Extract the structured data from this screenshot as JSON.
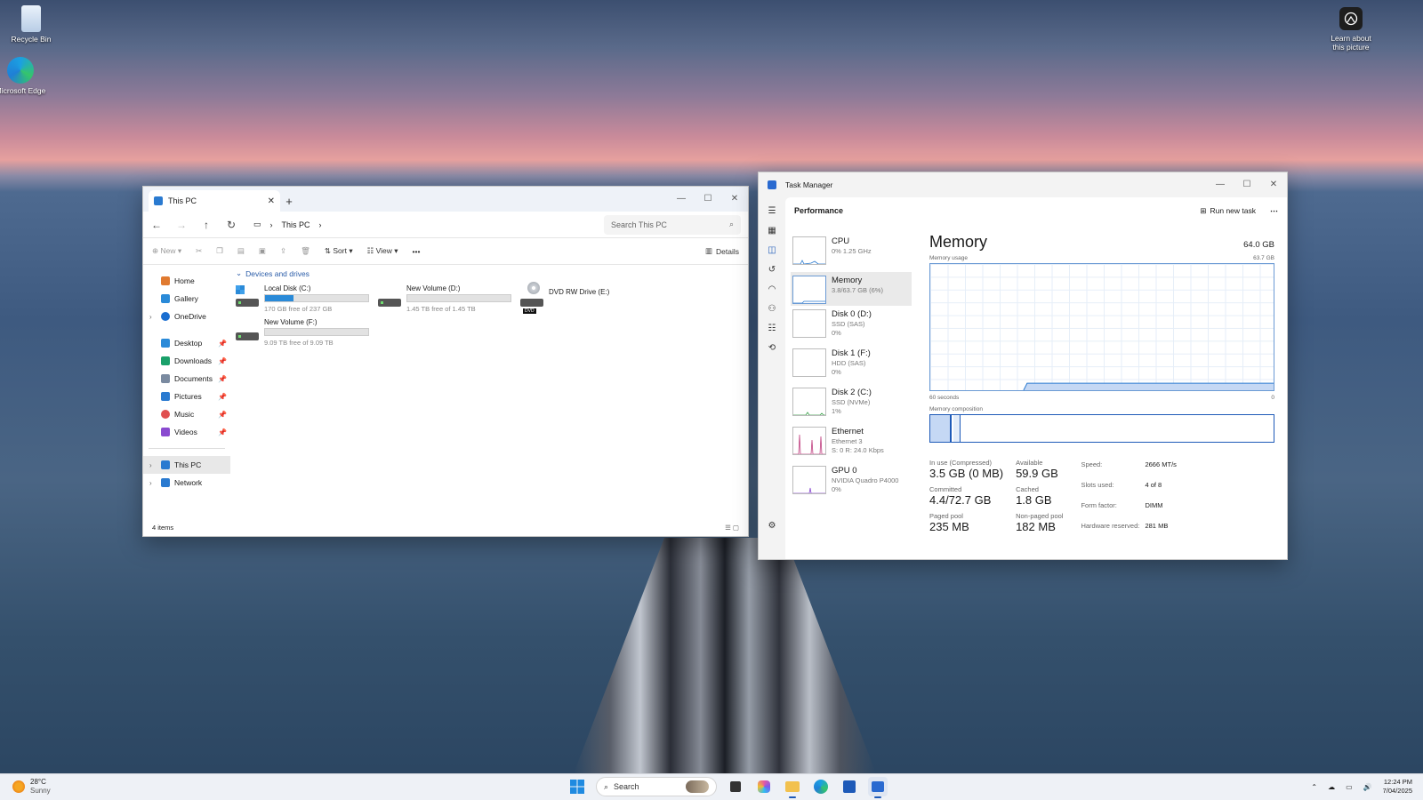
{
  "desktop": {
    "icons": [
      {
        "label": "Recycle Bin"
      },
      {
        "label": "Microsoft Edge"
      }
    ],
    "learn_label_line1": "Learn about",
    "learn_label_line2": "this picture"
  },
  "explorer": {
    "tab_title": "This PC",
    "address": "This PC",
    "search_placeholder": "Search This PC",
    "toolbar": {
      "new": "New",
      "sort": "Sort",
      "view": "View",
      "more": "•••",
      "details": "Details"
    },
    "sidebar": {
      "home": "Home",
      "gallery": "Gallery",
      "onedrive": "OneDrive",
      "desktop": "Desktop",
      "downloads": "Downloads",
      "documents": "Documents",
      "pictures": "Pictures",
      "music": "Music",
      "videos": "Videos",
      "this_pc": "This PC",
      "network": "Network"
    },
    "section_title": "Devices and drives",
    "drives": [
      {
        "name": "Local Disk (C:)",
        "free": "170 GB free of 237 GB",
        "used_fraction": 0.28
      },
      {
        "name": "New Volume (D:)",
        "free": "1.45 TB free of 1.45 TB",
        "used_fraction": 0.0
      },
      {
        "name": "DVD RW Drive (E:)",
        "badge": "DVD"
      },
      {
        "name": "New Volume (F:)",
        "free": "9.09 TB free of 9.09 TB",
        "used_fraction": 0.0
      }
    ],
    "status": "4 items"
  },
  "taskmgr": {
    "title": "Task Manager",
    "page": "Performance",
    "run_new_task": "Run new task",
    "resources": [
      {
        "name": "CPU",
        "sub1": "0% 1.25 GHz",
        "sub2": ""
      },
      {
        "name": "Memory",
        "sub1": "3.8/63.7 GB (6%)",
        "sub2": ""
      },
      {
        "name": "Disk 0 (D:)",
        "sub1": "SSD (SAS)",
        "sub2": "0%"
      },
      {
        "name": "Disk 1 (F:)",
        "sub1": "HDD (SAS)",
        "sub2": "0%"
      },
      {
        "name": "Disk 2 (C:)",
        "sub1": "SSD (NVMe)",
        "sub2": "1%"
      },
      {
        "name": "Ethernet",
        "sub1": "Ethernet 3",
        "sub2": "S: 0 R: 24.0 Kbps"
      },
      {
        "name": "GPU 0",
        "sub1": "NVIDIA Quadro P4000",
        "sub2": "0%"
      }
    ],
    "memory": {
      "title": "Memory",
      "total": "64.0 GB",
      "usage_label": "Memory usage",
      "usage_max": "63.7 GB",
      "axis_left": "60 seconds",
      "axis_right": "0",
      "composition_label": "Memory composition",
      "stats": {
        "in_use_label": "In use (Compressed)",
        "in_use": "3.5 GB (0 MB)",
        "available_label": "Available",
        "available": "59.9 GB",
        "committed_label": "Committed",
        "committed": "4.4/72.7 GB",
        "cached_label": "Cached",
        "cached": "1.8 GB",
        "paged_label": "Paged pool",
        "paged": "235 MB",
        "nonpaged_label": "Non-paged pool",
        "nonpaged": "182 MB"
      },
      "details": [
        {
          "k": "Speed:",
          "v": "2666 MT/s"
        },
        {
          "k": "Slots used:",
          "v": "4 of 8"
        },
        {
          "k": "Form factor:",
          "v": "DIMM"
        },
        {
          "k": "Hardware reserved:",
          "v": "281 MB"
        }
      ]
    }
  },
  "taskbar": {
    "temp": "28°C",
    "weather": "Sunny",
    "search": "Search",
    "time": "12:24 PM",
    "date": "7/04/2025"
  },
  "colors": {
    "accent": "#1e5ab8",
    "drive_fill": "#2a8ad8"
  }
}
